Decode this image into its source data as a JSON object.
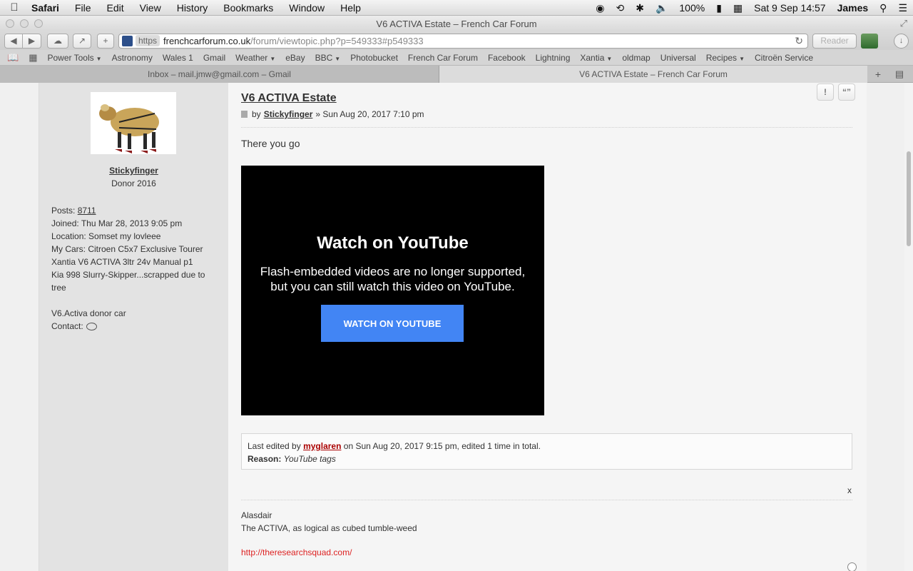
{
  "menubar": {
    "app": "Safari",
    "items": [
      "File",
      "Edit",
      "View",
      "History",
      "Bookmarks",
      "Window",
      "Help"
    ],
    "battery": "100%",
    "datetime": "Sat 9 Sep  14:57",
    "user": "James"
  },
  "window": {
    "title": "V6 ACTIVA Estate – French Car Forum"
  },
  "toolbar": {
    "https_label": "https",
    "url_domain": "frenchcarforum.co.uk",
    "url_path": "/forum/viewtopic.php?p=549333#p549333",
    "reader_label": "Reader"
  },
  "bookmarks": [
    {
      "label": "Power Tools",
      "menu": true
    },
    {
      "label": "Astronomy",
      "menu": false
    },
    {
      "label": "Wales 1",
      "menu": false
    },
    {
      "label": "Gmail",
      "menu": false
    },
    {
      "label": "Weather",
      "menu": true
    },
    {
      "label": "eBay",
      "menu": false
    },
    {
      "label": "BBC",
      "menu": true
    },
    {
      "label": "Photobucket",
      "menu": false
    },
    {
      "label": "French Car Forum",
      "menu": false
    },
    {
      "label": "Facebook",
      "menu": false
    },
    {
      "label": "Lightning",
      "menu": false
    },
    {
      "label": "Xantia",
      "menu": true
    },
    {
      "label": "oldmap",
      "menu": false
    },
    {
      "label": "Universal",
      "menu": false
    },
    {
      "label": "Recipes",
      "menu": true
    },
    {
      "label": "Citroën Service",
      "menu": false
    }
  ],
  "tabs": [
    {
      "label": "Inbox – mail.jmw@gmail.com – Gmail",
      "active": false
    },
    {
      "label": "V6 ACTIVA Estate – French Car Forum",
      "active": true
    }
  ],
  "profile": {
    "username": "Stickyfinger",
    "rank": "Donor 2016",
    "posts_label": "Posts:",
    "posts_value": "8711",
    "joined": "Joined: Thu Mar 28, 2013 9:05 pm",
    "location": "Location: Somset my lovleee",
    "cars_line1": "My Cars: Citroen C5x7 Exclusive Tourer",
    "cars_line2": "Xantia V6 ACTIVA 3ltr 24v Manual p1",
    "cars_line3": "Kia 998 Slurry-Skipper...scrapped due to",
    "cars_line4": "tree",
    "donor_note": "V6.Activa donor car",
    "contact_label": "Contact:"
  },
  "post": {
    "title": "V6 ACTIVA Estate",
    "by": "by",
    "author": "Stickyfinger",
    "date": "» Sun Aug 20, 2017 7:10 pm",
    "report_icon_label": "!",
    "quote_icon_label": "“”",
    "body": "There you go",
    "video": {
      "title": "Watch on YouTube",
      "message_line1": "Flash-embedded videos are no longer supported,",
      "message_line2": "but you can still watch this video on YouTube.",
      "button": "WATCH ON YOUTUBE"
    },
    "edit_prefix": "Last edited by",
    "editor": "myglaren",
    "edit_suffix": "on Sun Aug 20, 2017 9:15 pm, edited 1 time in total.",
    "reason_label": "Reason:",
    "reason": "YouTube tags",
    "close_label": "x",
    "signature_line1": "Alasdair",
    "signature_line2": "The ACTIVA, as logical as cubed tumble-weed",
    "signature_link": "http://theresearchsquad.com/"
  }
}
